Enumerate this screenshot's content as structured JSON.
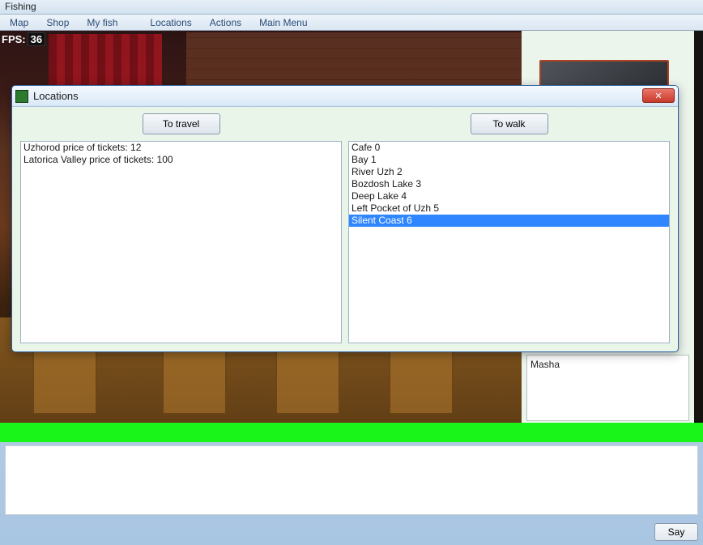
{
  "window": {
    "title": "Fishing"
  },
  "menu": {
    "map": "Map",
    "shop": "Shop",
    "myfish": "My fish",
    "locations": "Locations",
    "actions": "Actions",
    "mainmenu": "Main Menu"
  },
  "fps": {
    "label": "FPS:",
    "value": "36"
  },
  "side": {
    "name": "Masha"
  },
  "say": {
    "label": "Say"
  },
  "locations_dialog": {
    "title": "Locations",
    "travel_button": "To travel",
    "walk_button": "To walk",
    "close": "✕",
    "travel_items": [
      "Uzhorod price of tickets: 12",
      "Latorica Valley price of tickets: 100"
    ],
    "walk_items": [
      "Cafe 0",
      "Bay 1",
      "River Uzh 2",
      "Bozdosh Lake 3",
      "Deep Lake 4",
      "Left Pocket of Uzh 5",
      "Silent Coast 6"
    ],
    "walk_selected_index": 6
  }
}
